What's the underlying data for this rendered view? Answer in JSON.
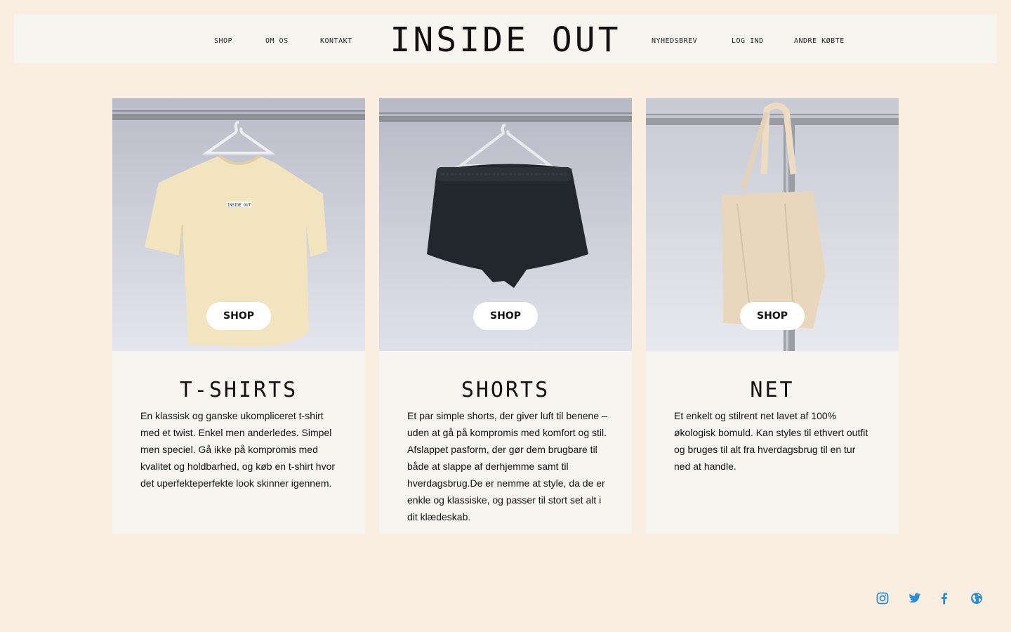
{
  "nav": {
    "left": [
      "SHOP",
      "OM OS",
      "KONTAKT"
    ],
    "right": [
      "NYHEDSBREV",
      "LOG IND",
      "ANDRE KØBTE"
    ],
    "logo": "INSIDE OUT"
  },
  "products": [
    {
      "image": "t-shirt-on-hanger",
      "button": "SHOP",
      "title": "T-SHIRTS",
      "text": "En klassisk og ganske ukompliceret t-shirt med et twist. Enkel men anderledes. Simpel men speciel. Gå ikke på kompromis med kvalitet og holdbarhed, og køb en t-shirt hvor det uperfekteperfekte look skinner igennem."
    },
    {
      "image": "black-shorts-on-hanger",
      "button": "SHOP",
      "title": "SHORTS",
      "text": "Et par simple shorts, der giver luft til benene – uden at gå på kompromis med komfort og stil. Afslappet pasform, der gør dem brugbare til både at slappe af derhjemme samt til hverdagsbrug.De er nemme at style, da de er enkle og klassiske, og passer til stort set alt i dit klædeskab."
    },
    {
      "image": "tote-bag-on-rail",
      "button": "SHOP",
      "title": "NET",
      "text": "Et enkelt og stilrent net lavet af 100% økologisk bomuld. Kan styles til ethvert outfit og bruges til alt fra hverdagsbrug til en tur ned at handle."
    }
  ],
  "tshirt_print": "INSIDE OUT",
  "social_icons": [
    "instagram-icon",
    "twitter-icon",
    "facebook-icon",
    "globe-icon"
  ],
  "colors": {
    "page_bg": "#faeee0",
    "panel_bg": "#f6f5ef",
    "button_bg": "#ffffff",
    "icon_blue": "#2b8fd6"
  }
}
